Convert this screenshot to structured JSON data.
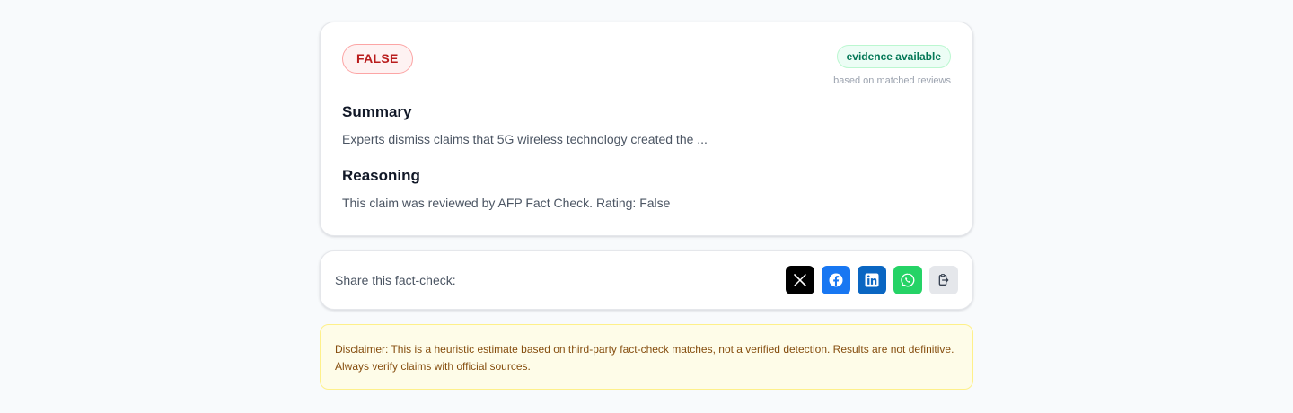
{
  "result": {
    "verdict": "FALSE",
    "evidence_badge": "evidence available",
    "evidence_note": "based on matched reviews",
    "summary_title": "Summary",
    "summary_text": "Experts dismiss claims that 5G wireless technology created the ...",
    "reasoning_title": "Reasoning",
    "reasoning_text": "This claim was reviewed by AFP Fact Check. Rating: False"
  },
  "share": {
    "label": "Share this fact-check:",
    "buttons": [
      {
        "icon": "x-logo-icon",
        "color": "#000000"
      },
      {
        "icon": "facebook-icon",
        "color": "#1877f2"
      },
      {
        "icon": "linkedin-icon",
        "color": "#0a66c2"
      },
      {
        "icon": "whatsapp-icon",
        "color": "#25d366"
      },
      {
        "icon": "copy-link-icon",
        "color": "#e5e7eb"
      }
    ]
  },
  "disclaimer": "Disclaimer: This is a heuristic estimate based on third-party fact-check matches, not a verified detection. Results are not definitive. Always verify claims with official sources.",
  "colors": {
    "verdict": "#b91c1c",
    "evidence": "#047857",
    "disclaimer_bg": "#fefce8"
  }
}
